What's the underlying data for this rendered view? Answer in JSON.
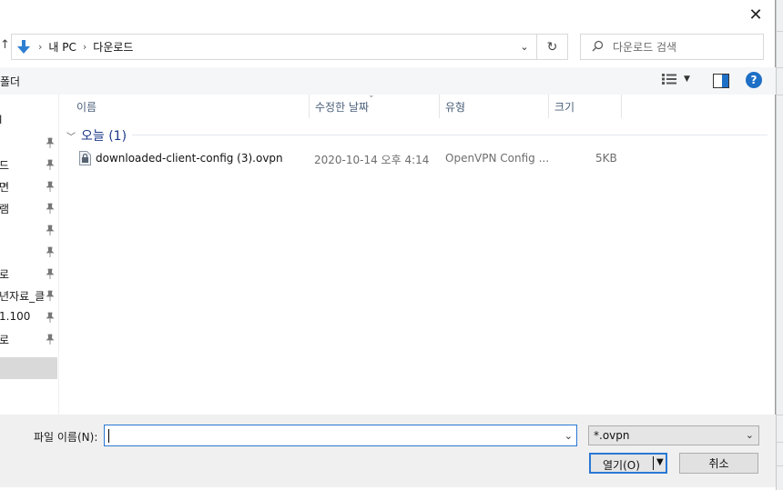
{
  "address": {
    "icon": "download-arrow-icon",
    "path": [
      "내 PC",
      "다운로드"
    ]
  },
  "search": {
    "placeholder": "다운로드 검색"
  },
  "toolbar": {
    "new_folder_label": "새 폴더",
    "new_folder_visible": "폴더"
  },
  "nav_items": [
    {
      "label": "l",
      "pinned": false
    },
    {
      "label": "",
      "pinned": true
    },
    {
      "label": "드",
      "pinned": true
    },
    {
      "label": "면",
      "pinned": true
    },
    {
      "label": "램",
      "pinned": true
    },
    {
      "label": "",
      "pinned": true
    },
    {
      "label": "",
      "pinned": true
    },
    {
      "label": "로",
      "pinned": true
    },
    {
      "label": "년자료_클",
      "pinned": true
    },
    {
      "label": "1.100",
      "pinned": true
    },
    {
      "label": "로",
      "pinned": true
    }
  ],
  "columns": [
    {
      "label": "이름"
    },
    {
      "label": "수정한 날짜"
    },
    {
      "label": "유형"
    },
    {
      "label": "크기"
    }
  ],
  "group": {
    "label": "오늘 (1)"
  },
  "files": [
    {
      "name": "downloaded-client-config (3).ovpn",
      "date": "2020-10-14 오후 4:14",
      "type": "OpenVPN Config ...",
      "size": "5KB"
    }
  ],
  "bottom": {
    "filename_label": "파일 이름(N):",
    "filename_value": "",
    "filter_value": "*.ovpn",
    "open_label": "열기(O)",
    "cancel_label": "취소"
  },
  "colors": {
    "accent": "#1e6fc6",
    "focus_border": "#2a78d4",
    "group_text": "#1e3a8a"
  }
}
